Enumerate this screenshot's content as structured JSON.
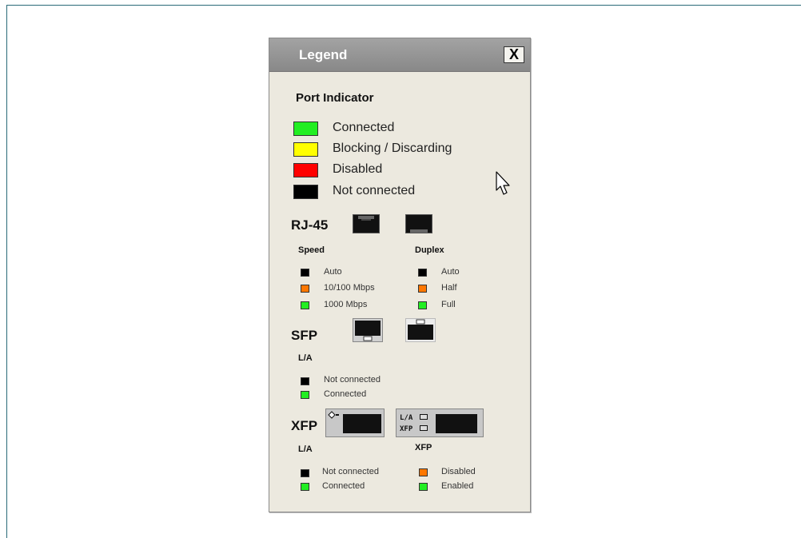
{
  "legend": {
    "title": "Legend",
    "close_label": "X",
    "port_indicator": {
      "title": "Port Indicator",
      "items": [
        {
          "label": "Connected",
          "color": "#22ee22"
        },
        {
          "label": "Blocking / Discarding",
          "color": "#ffff00"
        },
        {
          "label": "Disabled",
          "color": "#ff0000"
        },
        {
          "label": "Not connected",
          "color": "#000000"
        }
      ]
    },
    "rj45": {
      "label": "RJ-45",
      "speed": {
        "title": "Speed",
        "items": [
          {
            "label": "Auto",
            "color": "#000000"
          },
          {
            "label": "10/100 Mbps",
            "color": "#ff7700"
          },
          {
            "label": "1000 Mbps",
            "color": "#22ee22"
          }
        ]
      },
      "duplex": {
        "title": "Duplex",
        "items": [
          {
            "label": "Auto",
            "color": "#000000"
          },
          {
            "label": "Half",
            "color": "#ff7700"
          },
          {
            "label": "Full",
            "color": "#22ee22"
          }
        ]
      }
    },
    "sfp": {
      "label": "SFP",
      "la": {
        "title": "L/A",
        "items": [
          {
            "label": "Not connected",
            "color": "#000000"
          },
          {
            "label": "Connected",
            "color": "#22ee22"
          }
        ]
      }
    },
    "xfp": {
      "label": "XFP",
      "module_labels": {
        "la": "L/A",
        "xfp": "XFP"
      },
      "la": {
        "title": "L/A",
        "items": [
          {
            "label": "Not connected",
            "color": "#000000"
          },
          {
            "label": "Connected",
            "color": "#22ee22"
          }
        ]
      },
      "xfp_status": {
        "title": "XFP",
        "items": [
          {
            "label": "Disabled",
            "color": "#ff7700"
          },
          {
            "label": "Enabled",
            "color": "#22ee22"
          }
        ]
      }
    }
  }
}
